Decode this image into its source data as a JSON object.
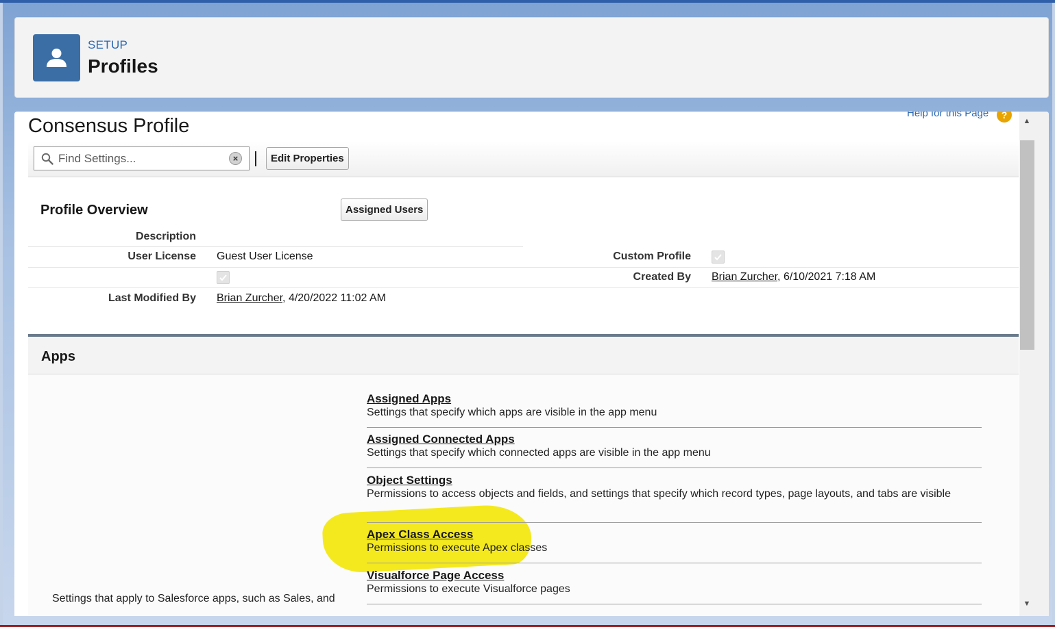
{
  "header": {
    "setup_label": "SETUP",
    "title": "Profiles",
    "icon": "user-icon"
  },
  "help": {
    "link_label": "Help for this Page",
    "icon": "help-icon"
  },
  "profile": {
    "name": "Consensus Profile"
  },
  "toolbar": {
    "search_placeholder": "Find Settings...",
    "edit_properties_label": "Edit Properties"
  },
  "overview": {
    "title": "Profile Overview",
    "assigned_users_label": "Assigned Users",
    "description_label": "Description",
    "description_value": "",
    "user_license_label": "User License",
    "user_license_value": "Guest User License",
    "custom_profile_label": "Custom Profile",
    "custom_profile_checked": true,
    "unlabeled_checkbox_checked": true,
    "created_by_label": "Created By",
    "created_by_user": "Brian Zurcher",
    "created_by_date": ", 6/10/2021 7:18 AM",
    "last_modified_label": "Last Modified By",
    "last_modified_user": "Brian Zurcher",
    "last_modified_date": ", 4/20/2022 11:02 AM"
  },
  "apps": {
    "title": "Apps",
    "description": "Settings that apply to Salesforce apps, such as Sales, and",
    "items": [
      {
        "title": "Assigned Apps",
        "text": "Settings that specify which apps are visible in the app menu"
      },
      {
        "title": "Assigned Connected Apps",
        "text": "Settings that specify which connected apps are visible in the app menu"
      },
      {
        "title": "Object Settings",
        "text": "Permissions to access objects and fields, and settings that specify which record types, page layouts, and tabs are visible"
      },
      {
        "title": "Apex Class Access",
        "text": "Permissions to execute Apex classes"
      },
      {
        "title": "Visualforce Page Access",
        "text": "Permissions to execute Visualforce pages"
      }
    ]
  },
  "colors": {
    "brand_blue": "#3a6ea5",
    "link_blue": "#2a67b1",
    "highlight": "#f2e600"
  }
}
